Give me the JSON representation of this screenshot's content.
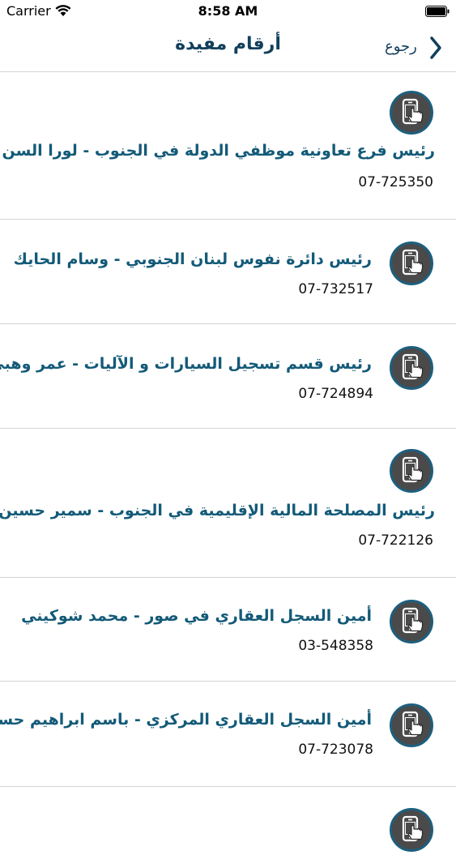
{
  "status_bar": {
    "carrier": "Carrier",
    "time": "8:58 AM"
  },
  "nav": {
    "title": "أرقام مفيدة",
    "back_label": "رجوع"
  },
  "contacts": [
    {
      "title": "رئيس فرع تعاونية موظفي الدولة في الجنوب - لورا السن",
      "number": "07-725350"
    },
    {
      "title": "رئيس دائرة نفوس لبنان الجنوبي - وسام الحايك",
      "number": "07-732517"
    },
    {
      "title": "رئيس قسم تسجيل السيارات و الآليات - عمر وهبي",
      "number": "07-724894"
    },
    {
      "title": "رئيس المصلحة المالية الإقليمية في الجنوب - سمير حسين",
      "number": "07-722126"
    },
    {
      "title": "أمين السجل العقاري في صور - محمد شوكيني",
      "number": "03-548358"
    },
    {
      "title": "أمين السجل العقاري المركزي - باسم ابراهيم حسن",
      "number": "07-723078"
    }
  ],
  "icons": {
    "call": "phone-touch-icon",
    "back": "chevron-left-icon"
  },
  "colors": {
    "title": "#123f5c",
    "row_title": "#135a78",
    "icon_bg": "#4a4a4a",
    "icon_border": "#1d5f7e"
  }
}
